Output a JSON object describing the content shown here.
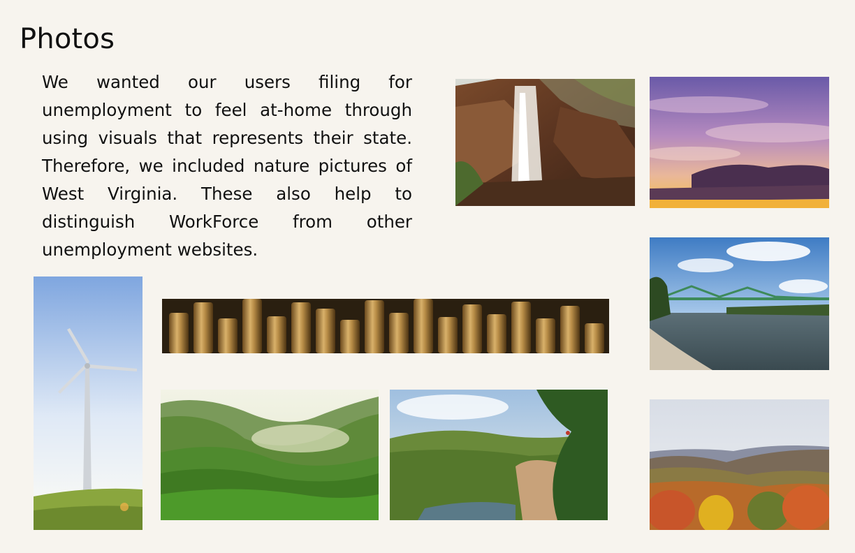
{
  "page": {
    "title": "Photos",
    "intro_text": "We wanted our users filing for unemployment to feel at-home through using visuals that represents their state. Therefore, we included nature pictures of West Virginia. These also help to distinguish WorkForce from other unemployment websites."
  },
  "photos": [
    {
      "name": "waterfall"
    },
    {
      "name": "sunset-sky"
    },
    {
      "name": "river-bridge"
    },
    {
      "name": "wind-turbine"
    },
    {
      "name": "brass-cylinders"
    },
    {
      "name": "misty-green-valley"
    },
    {
      "name": "gorge-overlook"
    },
    {
      "name": "autumn-hills"
    }
  ]
}
